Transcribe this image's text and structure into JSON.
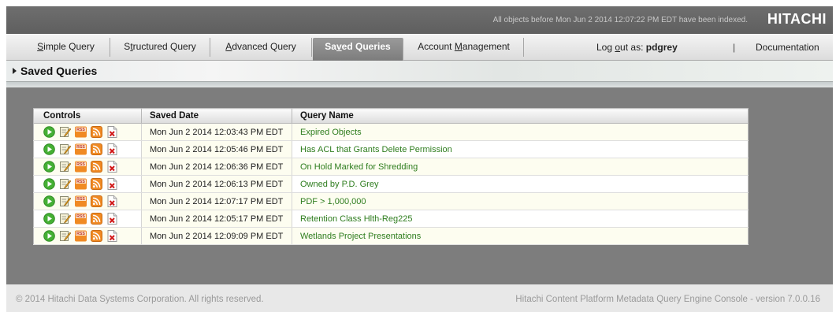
{
  "header": {
    "index_status": "All objects before Mon Jun 2 2014 12:07:22 PM EDT have been indexed.",
    "brand": "HITACHI"
  },
  "tabs": [
    {
      "pre": "",
      "key": "S",
      "post": "imple Query",
      "active": false
    },
    {
      "pre": "S",
      "key": "t",
      "post": "ructured Query",
      "active": false
    },
    {
      "pre": "",
      "key": "A",
      "post": "dvanced Query",
      "active": false
    },
    {
      "pre": "Sa",
      "key": "v",
      "post": "ed Queries",
      "active": true
    },
    {
      "pre": "Account ",
      "key": "M",
      "post": "anagement",
      "active": false
    }
  ],
  "account": {
    "logout_pre": "Log ",
    "logout_key": "o",
    "logout_post": "ut as:",
    "user": "pdgrey",
    "separator": "|",
    "documentation": "Documentation"
  },
  "section": {
    "title": "Saved Queries"
  },
  "table": {
    "headers": {
      "controls": "Controls",
      "saved_date": "Saved Date",
      "query_name": "Query Name"
    },
    "rows": [
      {
        "date": "Mon Jun 2 2014 12:03:43 PM EDT",
        "name": "Expired Objects"
      },
      {
        "date": "Mon Jun 2 2014 12:05:46 PM EDT",
        "name": "Has ACL that Grants Delete Permission"
      },
      {
        "date": "Mon Jun 2 2014 12:06:36 PM EDT",
        "name": "On Hold Marked for Shredding"
      },
      {
        "date": "Mon Jun 2 2014 12:06:13 PM EDT",
        "name": "Owned by P.D. Grey"
      },
      {
        "date": "Mon Jun 2 2014 12:07:17 PM EDT",
        "name": "PDF > 1,000,000"
      },
      {
        "date": "Mon Jun 2 2014 12:05:17 PM EDT",
        "name": "Retention Class Hlth-Reg225"
      },
      {
        "date": "Mon Jun 2 2014 12:09:09 PM EDT",
        "name": "Wetlands Project Presentations"
      }
    ],
    "row_icons": [
      "run-icon",
      "edit-icon",
      "rss-icon",
      "feed-icon",
      "delete-icon"
    ],
    "rss_badge": "RSS"
  },
  "footer": {
    "copyright": "© 2014 Hitachi Data Systems Corporation. All rights reserved.",
    "version": "Hitachi Content Platform Metadata Query Engine Console - version 7.0.0.16"
  },
  "colors": {
    "accent_green": "#2e7d1e",
    "run_green": "#45b035",
    "rss_orange": "#f08a24",
    "delete_red": "#d11a1a",
    "row_tint": "#fdfdf0"
  }
}
